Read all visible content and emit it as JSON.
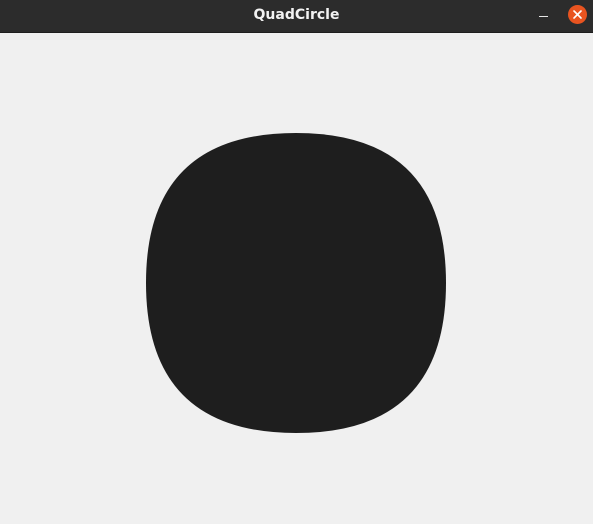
{
  "window": {
    "title": "QuadCircle"
  },
  "colors": {
    "titlebar": "#2c2c2c",
    "title_text": "#f2f2f2",
    "close_button": "#e95420",
    "canvas_background": "#f0f0f0",
    "shape_fill": "#1e1e1e"
  },
  "icons": {
    "minimize": "minimize-icon",
    "close": "close-icon"
  }
}
